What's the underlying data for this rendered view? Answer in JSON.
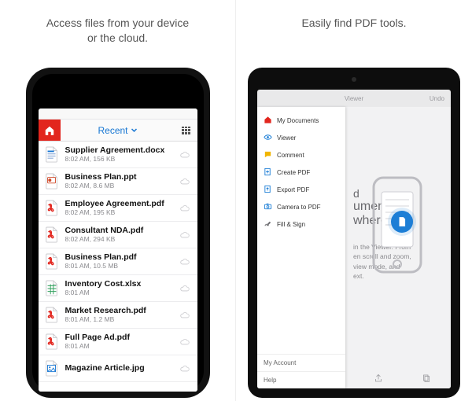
{
  "captions": {
    "left": "Access files from your device\nor the cloud.",
    "right": "Easily find PDF tools."
  },
  "phone": {
    "nav": {
      "title": "Recent",
      "list_view_label": "list-view"
    },
    "files": [
      {
        "name": "Supplier Agreement.docx",
        "meta": "8:02 AM, 156 KB",
        "icon": "word"
      },
      {
        "name": "Business Plan.ppt",
        "meta": "8:02 AM, 8.6 MB",
        "icon": "ppt"
      },
      {
        "name": "Employee Agreement.pdf",
        "meta": "8:02 AM, 195 KB",
        "icon": "pdf"
      },
      {
        "name": "Consultant NDA.pdf",
        "meta": "8:02 AM, 294 KB",
        "icon": "pdf"
      },
      {
        "name": "Business Plan.pdf",
        "meta": "8:01 AM, 10.5 MB",
        "icon": "pdf"
      },
      {
        "name": "Inventory Cost.xlsx",
        "meta": "8:01 AM",
        "icon": "xlsx"
      },
      {
        "name": "Market Research.pdf",
        "meta": "8:01 AM, 1.2 MB",
        "icon": "pdf"
      },
      {
        "name": "Full Page Ad.pdf",
        "meta": "8:01 AM",
        "icon": "pdf"
      },
      {
        "name": "Magazine Article.jpg",
        "meta": "",
        "icon": "jpg"
      }
    ]
  },
  "tablet": {
    "header": {
      "title": "Viewer",
      "right": "Undo"
    },
    "sidebar": {
      "items": [
        {
          "label": "My Documents",
          "icon": "house",
          "color": "#e2261e"
        },
        {
          "label": "Viewer",
          "icon": "eye",
          "color": "#1c7ed6"
        },
        {
          "label": "Comment",
          "icon": "comment",
          "color": "#f1b500"
        },
        {
          "label": "Create PDF",
          "icon": "create",
          "color": "#1c7ed6"
        },
        {
          "label": "Export PDF",
          "icon": "export",
          "color": "#1c7ed6"
        },
        {
          "label": "Camera to PDF",
          "icon": "camera",
          "color": "#1c7ed6"
        },
        {
          "label": "Fill & Sign",
          "icon": "sign",
          "color": "#6a6a6e"
        }
      ],
      "footer": [
        {
          "label": "My Account"
        },
        {
          "label": "Help"
        }
      ]
    },
    "hero": {
      "big_lines": [
        "d",
        "uments",
        "where"
      ],
      "desc_lines": [
        "in the Viewer. From",
        "en scroll and zoom,",
        "view mode, and",
        "ext."
      ]
    }
  }
}
